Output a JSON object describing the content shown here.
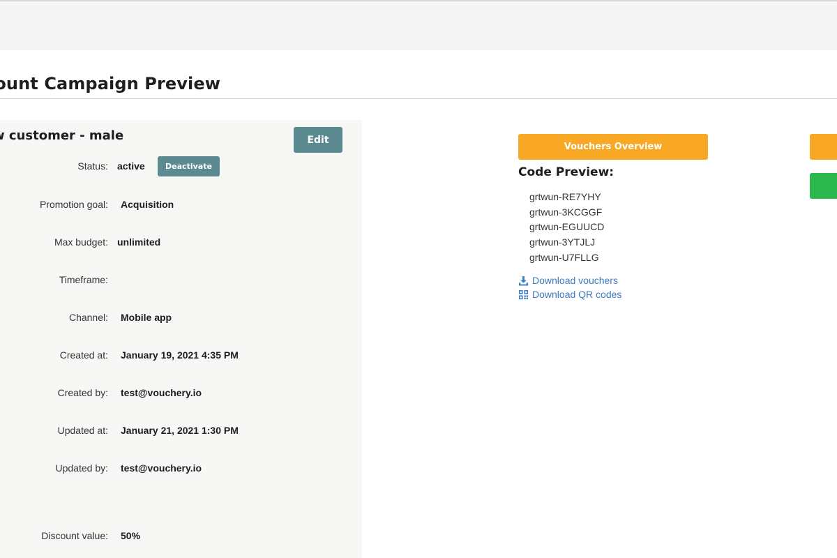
{
  "page": {
    "title": "count Campaign Preview"
  },
  "campaign": {
    "name": "w customer - male",
    "edit_label": "Edit",
    "deactivate_label": "Deactivate",
    "fields": {
      "status": {
        "label": "Status:",
        "value": "active"
      },
      "promotion_goal": {
        "label": "Promotion goal:",
        "value": "Acquisition"
      },
      "max_budget": {
        "label": "Max budget:",
        "value": "unlimited"
      },
      "timeframe": {
        "label": "Timeframe:",
        "value": ""
      },
      "channel": {
        "label": "Channel:",
        "value": "Mobile app"
      },
      "created_at": {
        "label": "Created at:",
        "value": "January 19, 2021 4:35 PM"
      },
      "created_by": {
        "label": "Created by:",
        "value": "test@vouchery.io"
      },
      "updated_at": {
        "label": "Updated at:",
        "value": "January 21, 2021 1:30 PM"
      },
      "updated_by": {
        "label": "Updated by:",
        "value": "test@vouchery.io"
      },
      "discount_value": {
        "label": "Discount value:",
        "value": "50%"
      }
    }
  },
  "vouchers": {
    "overview_label": "Vouchers Overview",
    "code_preview_title": "Code Preview:",
    "codes": [
      "grtwun-RE7YHY",
      "grtwun-3KCGGF",
      "grtwun-EGUUCD",
      "grtwun-3YTJLJ",
      "grtwun-U7FLLG"
    ],
    "download_vouchers_label": "Download vouchers",
    "download_qr_label": "Download QR codes"
  },
  "colors": {
    "accent_teal": "#5b8a91",
    "accent_orange": "#f9a825",
    "accent_green": "#2db84d",
    "link_blue": "#3a7bbf"
  },
  "icons": {
    "download": "download-icon",
    "qr": "qr-code-icon"
  }
}
